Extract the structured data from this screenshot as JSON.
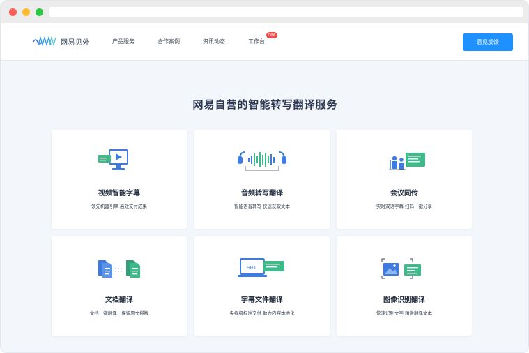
{
  "nav": {
    "brand": "网易见外",
    "items": [
      "产品服务",
      "合作案例",
      "资讯动态",
      "工作台"
    ],
    "new_badge": "new",
    "feedback_label": "意见反馈"
  },
  "headline": "网易自营的智能转写翻译服务",
  "cards": [
    {
      "title": "视频智能字幕",
      "desc": "领先机器引擎 高效交付成果",
      "icon": "video-monitor-icon"
    },
    {
      "title": "音频转写翻译",
      "desc": "智能语音转写 快速获取文本",
      "icon": "audio-headphones-icon"
    },
    {
      "title": "会议同传",
      "desc": "实时双语字幕 扫码一键分享",
      "icon": "meeting-icon"
    },
    {
      "title": "文档翻译",
      "desc": "文档一键翻译，保留原文排版",
      "icon": "document-icon"
    },
    {
      "title": "字幕文件翻译",
      "desc": "央视级标准交付 助力内容本地化",
      "icon": "subtitle-file-icon",
      "icon_text": "SRT"
    },
    {
      "title": "图像识别翻译",
      "desc": "快速识别文字 精准翻译文本",
      "icon": "image-recognition-icon"
    }
  ],
  "colors": {
    "accent": "#1e90ff",
    "icon_blue": "#3d7be0",
    "icon_green": "#3dbb8a",
    "badge": "#ef4a4a"
  }
}
